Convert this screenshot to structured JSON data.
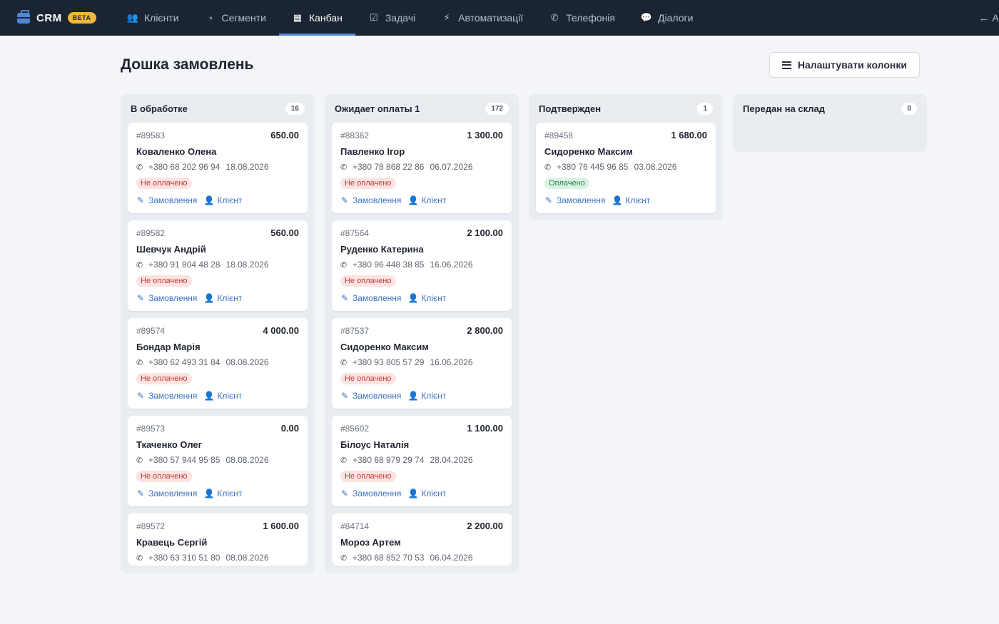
{
  "brand": {
    "name": "CRM",
    "badge": "BETA"
  },
  "nav": {
    "items": [
      {
        "label": "Клієнти",
        "icon": "users-icon",
        "glyph": "👥",
        "active": false
      },
      {
        "label": "Сегменти",
        "icon": "pie-chart-icon",
        "glyph": "◔",
        "active": false
      },
      {
        "label": "Канбан",
        "icon": "table-icon",
        "glyph": "▦",
        "active": true
      },
      {
        "label": "Задачі",
        "icon": "checkbox-icon",
        "glyph": "☑",
        "active": false
      },
      {
        "label": "Автоматизації",
        "icon": "bolt-icon",
        "glyph": "⚡",
        "active": false
      },
      {
        "label": "Телефонія",
        "icon": "phone-volume-icon",
        "glyph": "✆",
        "active": false
      },
      {
        "label": "Діалоги",
        "icon": "comments-icon",
        "glyph": "💬",
        "active": false
      }
    ],
    "back_label": "Ад"
  },
  "page": {
    "title": "Дошка замовлень",
    "configure_button": "Налаштувати колонки"
  },
  "labels": {
    "order_link": "Замовлення",
    "client_link": "Клієнт"
  },
  "colors": {
    "accent": "#4d86d6",
    "nav_bg": "#1b2432",
    "unpaid_bg": "#fbe3e2",
    "unpaid_fg": "#c03e37",
    "paid_bg": "#dcf3e4",
    "paid_fg": "#1f8a4a",
    "link": "#3e73c4"
  },
  "columns": [
    {
      "title": "В обработке",
      "count": "16",
      "cards": [
        {
          "number": "#89583",
          "amount": "650.00",
          "client": "Коваленко Олена",
          "phone": "+380 68 202 96 94",
          "date": "18.08.2026",
          "status": "Не оплачено",
          "paid": false
        },
        {
          "number": "#89582",
          "amount": "560.00",
          "client": "Шевчук Андрій",
          "phone": "+380 91 804 48 28",
          "date": "18.08.2026",
          "status": "Не оплачено",
          "paid": false
        },
        {
          "number": "#89574",
          "amount": "4 000.00",
          "client": "Бондар Марія",
          "phone": "+380 62 493 31 84",
          "date": "08.08.2026",
          "status": "Не оплачено",
          "paid": false
        },
        {
          "number": "#89573",
          "amount": "0.00",
          "client": "Ткаченко Олег",
          "phone": "+380 57 944 95 85",
          "date": "08.08.2026",
          "status": "Не оплачено",
          "paid": false
        },
        {
          "number": "#89572",
          "amount": "1 600.00",
          "client": "Кравець Сергій",
          "phone": "+380 63 310 51 80",
          "date": "08.08.2026",
          "status": "",
          "paid": false
        }
      ]
    },
    {
      "title": "Ожидает оплаты 1",
      "count": "172",
      "cards": [
        {
          "number": "#88362",
          "amount": "1 300.00",
          "client": "Павленко Ігор",
          "phone": "+380 78 868 22 86",
          "date": "06.07.2026",
          "status": "Не оплачено",
          "paid": false
        },
        {
          "number": "#87564",
          "amount": "2 100.00",
          "client": "Руденко Катерина",
          "phone": "+380 96 448 38 85",
          "date": "16.06.2026",
          "status": "Не оплачено",
          "paid": false
        },
        {
          "number": "#87537",
          "amount": "2 800.00",
          "client": "Сидоренко Максим",
          "phone": "+380 93 805 57 29",
          "date": "16.06.2026",
          "status": "Не оплачено",
          "paid": false
        },
        {
          "number": "#85602",
          "amount": "1 100.00",
          "client": "Білоус Наталія",
          "phone": "+380 68 979 29 74",
          "date": "28.04.2026",
          "status": "Не оплачено",
          "paid": false
        },
        {
          "number": "#84714",
          "amount": "2 200.00",
          "client": "Мороз Артем",
          "phone": "+380 68 852 70 53",
          "date": "06.04.2026",
          "status": "",
          "paid": false
        }
      ]
    },
    {
      "title": "Подтвержден",
      "count": "1",
      "cards": [
        {
          "number": "#89458",
          "amount": "1 680.00",
          "client": "Сидоренко Максим",
          "phone": "+380 76 445 96 85",
          "date": "03.08.2026",
          "status": "Оплачено",
          "paid": true
        }
      ]
    },
    {
      "title": "Передан на склад",
      "count": "0",
      "cards": []
    }
  ]
}
